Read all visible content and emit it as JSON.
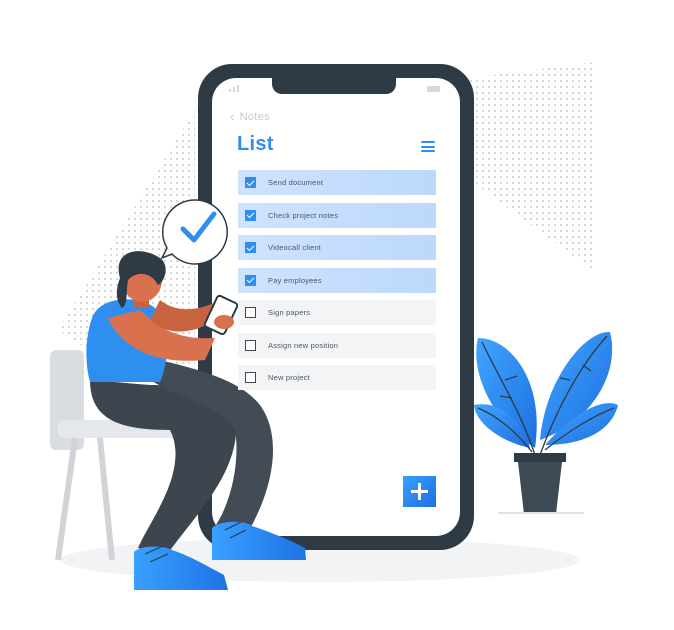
{
  "screen": {
    "back_label": "Notes",
    "title": "List",
    "tasks": [
      {
        "label": "Send document",
        "done": true
      },
      {
        "label": "Check project notes",
        "done": true
      },
      {
        "label": "Videocall client",
        "done": true
      },
      {
        "label": "Pay employees",
        "done": true
      },
      {
        "label": "Sign papers",
        "done": false
      },
      {
        "label": "Assign new position",
        "done": false
      },
      {
        "label": "New project",
        "done": false
      }
    ]
  },
  "icons": {
    "back": "chevron-left-icon",
    "menu": "hamburger-menu-icon",
    "add": "plus-icon",
    "bubble": "checkmark-icon"
  },
  "colors": {
    "accent": "#2f8ff0",
    "phone_frame": "#2e3b45",
    "task_done_bg": "#c6ddfe",
    "task_todo_bg": "#f3f4f6",
    "plant_leaf": "#2f8ff0",
    "skin": "#d9714e"
  }
}
